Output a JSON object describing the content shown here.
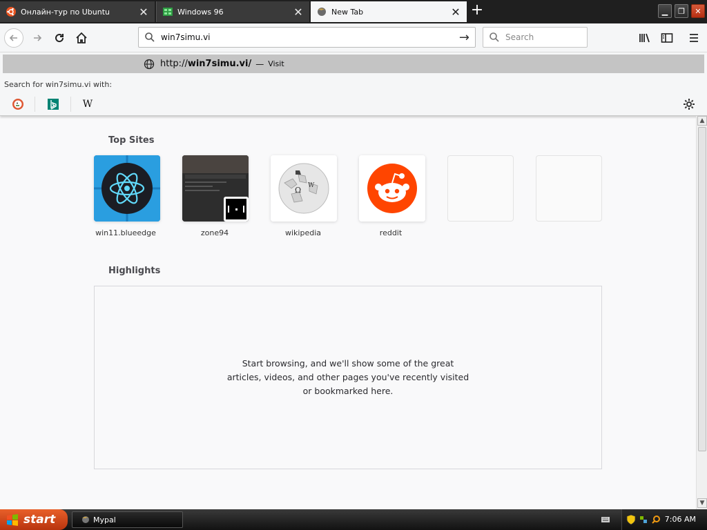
{
  "tabs": [
    {
      "title": "Онлайн-тур по Ubuntu",
      "icon": "ubuntu-icon",
      "active": false
    },
    {
      "title": "Windows 96",
      "icon": "windows96-icon",
      "active": false
    },
    {
      "title": "New Tab",
      "icon": "firefox-icon",
      "active": true
    }
  ],
  "toolbar": {
    "url_value": "win7simu.vi",
    "search_placeholder": "Search"
  },
  "dropdown": {
    "suggestion_prefix": "http://",
    "suggestion_domain": "win7simu.vi/",
    "suggestion_dash": "—",
    "suggestion_action": "Visit",
    "search_for_label": "Search for",
    "search_for_term": "win7simu.vi",
    "search_for_suffix": "with:",
    "engines": [
      "duckduckgo-icon",
      "bing-icon",
      "wikipedia-icon"
    ]
  },
  "content": {
    "top_sites_title": "Top Sites",
    "top_sites": [
      {
        "label": "win11.blueedge",
        "icon": "react-atom-icon"
      },
      {
        "label": "zone94",
        "icon": "pong-icon"
      },
      {
        "label": "wikipedia",
        "icon": "wikipedia-globe-icon"
      },
      {
        "label": "reddit",
        "icon": "reddit-icon"
      },
      {
        "label": "",
        "icon": ""
      },
      {
        "label": "",
        "icon": ""
      }
    ],
    "highlights_title": "Highlights",
    "highlights_message": "Start browsing, and we'll show some of the great articles, videos, and other pages you've recently visited or bookmarked here."
  },
  "taskbar": {
    "start_label": "start",
    "task_item": "Mypal",
    "clock": "7:06 AM"
  },
  "colors": {
    "reddit": "#ff4500",
    "react_tile": "#1e90d8",
    "start_button": "#d44a1c"
  }
}
